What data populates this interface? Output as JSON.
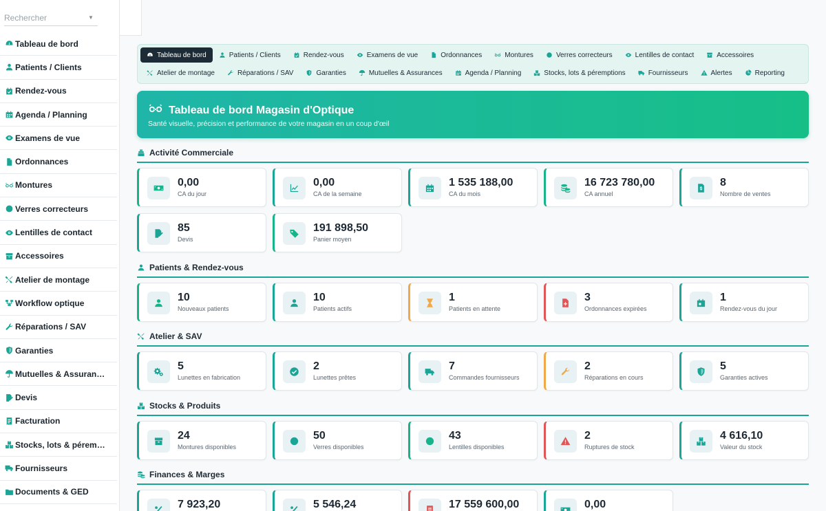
{
  "search": {
    "placeholder": "Rechercher"
  },
  "sidebar": {
    "items": [
      {
        "label": "Tableau de bord",
        "icon": "gauge-icon"
      },
      {
        "label": "Patients / Clients",
        "icon": "user-icon"
      },
      {
        "label": "Rendez-vous",
        "icon": "calendar-check-icon"
      },
      {
        "label": "Agenda / Planning",
        "icon": "calendar-icon"
      },
      {
        "label": "Examens de vue",
        "icon": "eye-icon"
      },
      {
        "label": "Ordonnances",
        "icon": "file-icon"
      },
      {
        "label": "Montures",
        "icon": "glasses-icon"
      },
      {
        "label": "Verres correcteurs",
        "icon": "circle-icon"
      },
      {
        "label": "Lentilles de contact",
        "icon": "eye-icon"
      },
      {
        "label": "Accessoires",
        "icon": "box-icon"
      },
      {
        "label": "Atelier de montage",
        "icon": "tools-icon"
      },
      {
        "label": "Workflow optique",
        "icon": "sitemap-icon"
      },
      {
        "label": "Réparations / SAV",
        "icon": "wrench-icon"
      },
      {
        "label": "Garanties",
        "icon": "shield-icon"
      },
      {
        "label": "Mutuelles & Assuran…",
        "icon": "umbrella-icon"
      },
      {
        "label": "Devis",
        "icon": "file-signature-icon"
      },
      {
        "label": "Facturation",
        "icon": "invoice-icon"
      },
      {
        "label": "Stocks, lots & pérem…",
        "icon": "boxes-icon"
      },
      {
        "label": "Fournisseurs",
        "icon": "truck-icon"
      },
      {
        "label": "Documents & GED",
        "icon": "folder-icon"
      }
    ]
  },
  "nav": {
    "row1": [
      {
        "label": "Tableau de bord",
        "icon": "gauge-icon",
        "active": true
      },
      {
        "label": "Patients / Clients",
        "icon": "user-icon"
      },
      {
        "label": "Rendez-vous",
        "icon": "calendar-check-icon"
      },
      {
        "label": "Examens de vue",
        "icon": "eye-icon"
      },
      {
        "label": "Ordonnances",
        "icon": "file-icon"
      },
      {
        "label": "Montures",
        "icon": "glasses-icon"
      },
      {
        "label": "Verres correcteurs",
        "icon": "circle-icon"
      },
      {
        "label": "Lentilles de contact",
        "icon": "eye-icon"
      },
      {
        "label": "Accessoires",
        "icon": "box-icon"
      }
    ],
    "row2": [
      {
        "label": "Atelier de montage",
        "icon": "tools-icon"
      },
      {
        "label": "Réparations / SAV",
        "icon": "wrench-icon"
      },
      {
        "label": "Garanties",
        "icon": "shield-icon"
      },
      {
        "label": "Mutuelles & Assurances",
        "icon": "umbrella-icon"
      },
      {
        "label": "Agenda / Planning",
        "icon": "calendar-icon"
      },
      {
        "label": "Stocks, lots & péremptions",
        "icon": "boxes-icon"
      },
      {
        "label": "Fournisseurs",
        "icon": "truck-icon"
      },
      {
        "label": "Alertes",
        "icon": "warning-icon"
      },
      {
        "label": "Reporting",
        "icon": "chart-pie-icon"
      }
    ]
  },
  "hero": {
    "title": "Tableau de bord Magasin d'Optique",
    "subtitle": "Santé visuelle, précision et performance de votre magasin en un coup d'œil",
    "icon": "glasses-icon"
  },
  "sections": [
    {
      "title": "Activité Commerciale",
      "icon": "cash-register-icon",
      "cards": [
        {
          "value": "0,00",
          "label": "CA du jour",
          "icon": "money-icon",
          "accent": "green"
        },
        {
          "value": "0,00",
          "label": "CA de la semaine",
          "icon": "chart-line-icon",
          "accent": "teal"
        },
        {
          "value": "1 535 188,00",
          "label": "CA du mois",
          "icon": "calendar-icon",
          "accent": "teal"
        },
        {
          "value": "16 723 780,00",
          "label": "CA annuel",
          "icon": "coins-icon",
          "accent": "green"
        },
        {
          "value": "8",
          "label": "Nombre de ventes",
          "icon": "receipt-icon",
          "accent": "teal"
        },
        {
          "value": "85",
          "label": "Devis",
          "icon": "file-signature-icon",
          "accent": "teal"
        },
        {
          "value": "191 898,50",
          "label": "Panier moyen",
          "icon": "tags-icon",
          "accent": "green"
        }
      ]
    },
    {
      "title": "Patients & Rendez-vous",
      "icon": "user-icon",
      "cards": [
        {
          "value": "10",
          "label": "Nouveaux patients",
          "icon": "user-icon",
          "accent": "green"
        },
        {
          "value": "10",
          "label": "Patients actifs",
          "icon": "user-icon",
          "accent": "teal"
        },
        {
          "value": "1",
          "label": "Patients en attente",
          "icon": "hourglass-icon",
          "accent": "orange"
        },
        {
          "value": "3",
          "label": "Ordonnances expirées",
          "icon": "file-medical-icon",
          "accent": "red"
        },
        {
          "value": "1",
          "label": "Rendez-vous du jour",
          "icon": "calendar-day-icon",
          "accent": "teal"
        }
      ]
    },
    {
      "title": "Atelier & SAV",
      "icon": "tools-icon",
      "cards": [
        {
          "value": "5",
          "label": "Lunettes en fabrication",
          "icon": "cogs-icon",
          "accent": "teal"
        },
        {
          "value": "2",
          "label": "Lunettes prêtes",
          "icon": "check-circle-icon",
          "accent": "teal"
        },
        {
          "value": "7",
          "label": "Commandes fournisseurs",
          "icon": "truck-icon",
          "accent": "teal"
        },
        {
          "value": "2",
          "label": "Réparations en cours",
          "icon": "wrench-icon",
          "accent": "orange"
        },
        {
          "value": "5",
          "label": "Garanties actives",
          "icon": "shield-icon",
          "accent": "teal"
        }
      ]
    },
    {
      "title": "Stocks & Produits",
      "icon": "boxes-icon",
      "cards": [
        {
          "value": "24",
          "label": "Montures disponibles",
          "icon": "box-icon",
          "accent": "teal"
        },
        {
          "value": "50",
          "label": "Verres disponibles",
          "icon": "circle-icon",
          "accent": "teal"
        },
        {
          "value": "43",
          "label": "Lentilles disponibles",
          "icon": "circle-icon",
          "accent": "green"
        },
        {
          "value": "2",
          "label": "Ruptures de stock",
          "icon": "warning-icon",
          "accent": "red"
        },
        {
          "value": "4 616,10",
          "label": "Valeur du stock",
          "icon": "boxes-icon",
          "accent": "teal"
        }
      ]
    },
    {
      "title": "Finances & Marges",
      "icon": "coins-icon",
      "cards": [
        {
          "value": "7 923,20",
          "label": "",
          "icon": "percent-icon",
          "accent": "teal"
        },
        {
          "value": "5 546,24",
          "label": "",
          "icon": "percent-icon",
          "accent": "teal"
        },
        {
          "value": "17 559 600,00",
          "label": "",
          "icon": "invoice-icon",
          "accent": "red"
        },
        {
          "value": "0,00",
          "label": "",
          "icon": "money-icon",
          "accent": "teal"
        }
      ]
    }
  ],
  "colors": {
    "accent_teal": "#1aa596",
    "accent_green": "#17b38a",
    "accent_orange": "#f0a94a",
    "accent_red": "#e05656",
    "nav_active_bg": "#1c2b36",
    "hero_gradient_start": "#1fb5a8",
    "hero_gradient_end": "#17bf87"
  }
}
